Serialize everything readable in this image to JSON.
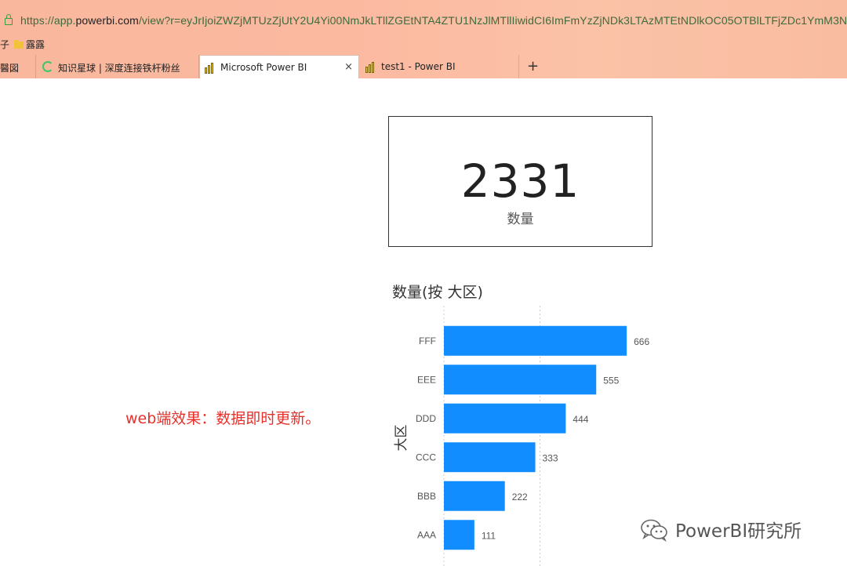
{
  "browser": {
    "url_scheme": "https://app.",
    "url_domain": "powerbi.com",
    "url_rest": "/view?r=eyJrIjoiZWZjMTUzZjUtY2U4Yi00NmJkLTllZGEtNTA4ZTU1NzJlMTllIiwidCI6ImFmYzZjNDk3LTAzMTEtNDlkOC05OTBlLTFjZDc1YmM3Nm\\",
    "bookmarks": [
      {
        "label": "子"
      },
      {
        "label": "露露"
      }
    ],
    "tabs": [
      {
        "label": "醫図"
      },
      {
        "label": "知识星球 | 深度连接铁杆粉丝"
      },
      {
        "label": "Microsoft Power BI",
        "active": true
      },
      {
        "label": "test1 - Power BI"
      }
    ],
    "close_glyph": "×",
    "new_tab_glyph": "+"
  },
  "card": {
    "value": "2331",
    "label": "数量"
  },
  "chart_data": {
    "type": "bar",
    "orientation": "horizontal",
    "title": "数量(按 大区)",
    "ylabel": "大区",
    "categories": [
      "FFF",
      "EEE",
      "DDD",
      "CCC",
      "BBB",
      "AAA"
    ],
    "values": [
      666,
      555,
      444,
      333,
      222,
      111
    ],
    "data_labels": [
      "666",
      "555",
      "444",
      "333",
      "222",
      "111"
    ],
    "bar_color": "#118dff",
    "xlim": [
      0,
      700
    ],
    "grid": "dotted vertical"
  },
  "annotation": {
    "text": "web端效果：数据即时更新。",
    "color": "#e8302a"
  },
  "watermark": {
    "text": "PowerBI研究所"
  }
}
